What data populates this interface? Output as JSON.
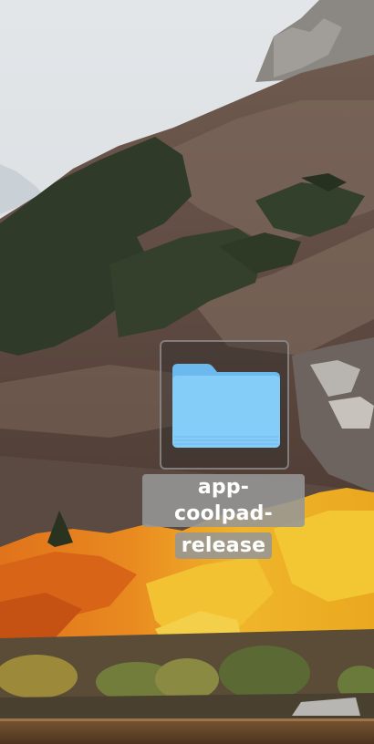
{
  "desktop": {
    "wallpaper_icon": "mountain-autumn-landscape",
    "colors": {
      "selection_bg": "#5a5a5a",
      "label_bg": "#969696",
      "folder_blue": "#7ecbf7"
    },
    "items": [
      {
        "icon": "folder-icon",
        "label_line1": "app-coolpad-",
        "label_line2": "release",
        "selected": true
      }
    ]
  }
}
